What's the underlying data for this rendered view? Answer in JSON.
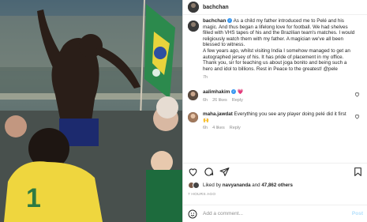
{
  "post": {
    "username": "bachchan",
    "caption": "As a child my father introduced me to Pelé and his magic. And thus began a lifelong love for football. We had shelves filled with VHS tapes of his and the Brazilian team's matches. I would religiously watch them with my father. A magician we've all been blessed to witness.\nA few years ago, whilst visiting India I somehow managed to get an autographed jersey of his. It has pride of placement in my office.\nThank you, sir for teaching us about joga bonito and being such a hero and idol to billions. Rest in Peace to the greatest! @pele",
    "caption_age": "7h"
  },
  "comments": [
    {
      "username": "aalimhakim",
      "text": "💗",
      "age": "6h",
      "likes": "26 likes",
      "reply": "Reply"
    },
    {
      "username": "maha.jawdat",
      "text": "Everything you see any player doing pelé did it first 🙌",
      "age": "6h",
      "likes": "4 likes",
      "reply": "Reply"
    }
  ],
  "likes": {
    "prefix": "Liked by",
    "user": "navyananda",
    "and": "and",
    "others": "47,862 others"
  },
  "timestamp": "7 HOURS AGO",
  "composer": {
    "placeholder": "Add a comment...",
    "post_label": "Post"
  },
  "colors": {
    "verified": "#3897f0",
    "link": "#b2dffc",
    "muted": "#8e8e8e"
  }
}
